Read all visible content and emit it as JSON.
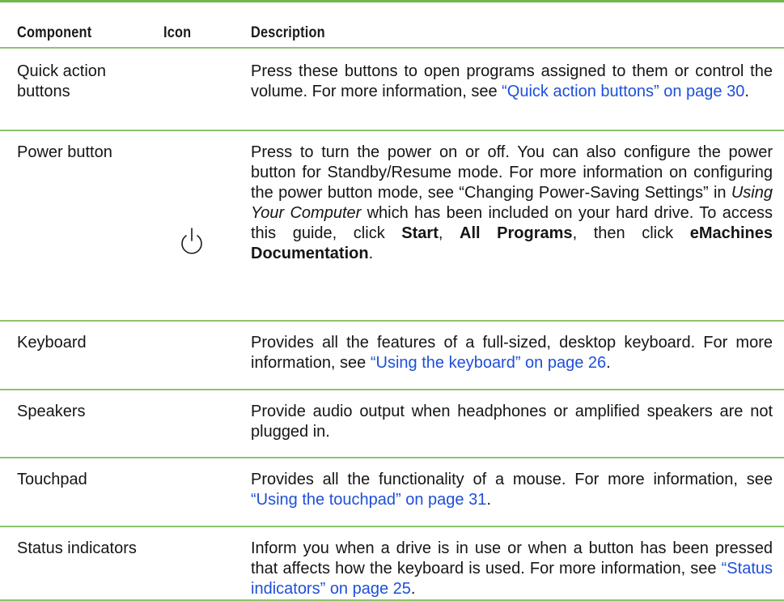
{
  "headers": {
    "component": "Component",
    "icon": "Icon",
    "description": "Description"
  },
  "rows": [
    {
      "component": "Quick action buttons",
      "icon": "",
      "desc_a": "Press these buttons to open programs assigned to them or control the volume. For more information, see ",
      "desc_link": "“Quick action buttons” on page 30",
      "desc_b": "."
    },
    {
      "component": "Power button",
      "icon": "power-icon",
      "desc_a": "Press to turn the power on or off. You can also configure the power button for Standby/Resume mode. For more information on configuring the power button mode, see “Changing Power-Saving Settings” in ",
      "desc_italic": "Using Your Computer",
      "desc_b": " which has been included on your hard drive. To access this guide, click ",
      "bold_1": "Start",
      "sep_1": ", ",
      "bold_2": "All Programs",
      "sep_2": ", then click ",
      "bold_3": "eMachines Documentation",
      "desc_end": "."
    },
    {
      "component": "Keyboard",
      "icon": "",
      "desc_a": "Provides all the features of a full-sized, desktop keyboard. For more information, see ",
      "desc_link": "“Using the keyboard” on page 26",
      "desc_b": "."
    },
    {
      "component": "Speakers",
      "icon": "",
      "desc_a": "Provide audio output when headphones or amplified speakers are not plugged in."
    },
    {
      "component": "Touchpad",
      "icon": "",
      "desc_a": "Provides all the functionality of a mouse. For more information, see ",
      "desc_link": "“Using the touchpad” on page 31",
      "desc_b": "."
    },
    {
      "component": "Status indicators",
      "icon": "",
      "desc_a": "Inform you when a drive is in use or when a button has been pressed that affects how the keyboard is used. For more information, see ",
      "desc_link": "“Status indicators” on page 25",
      "desc_b": "."
    }
  ],
  "colors": {
    "rule": "#8cc46b",
    "link": "#1e4fd9",
    "text": "#151515"
  }
}
